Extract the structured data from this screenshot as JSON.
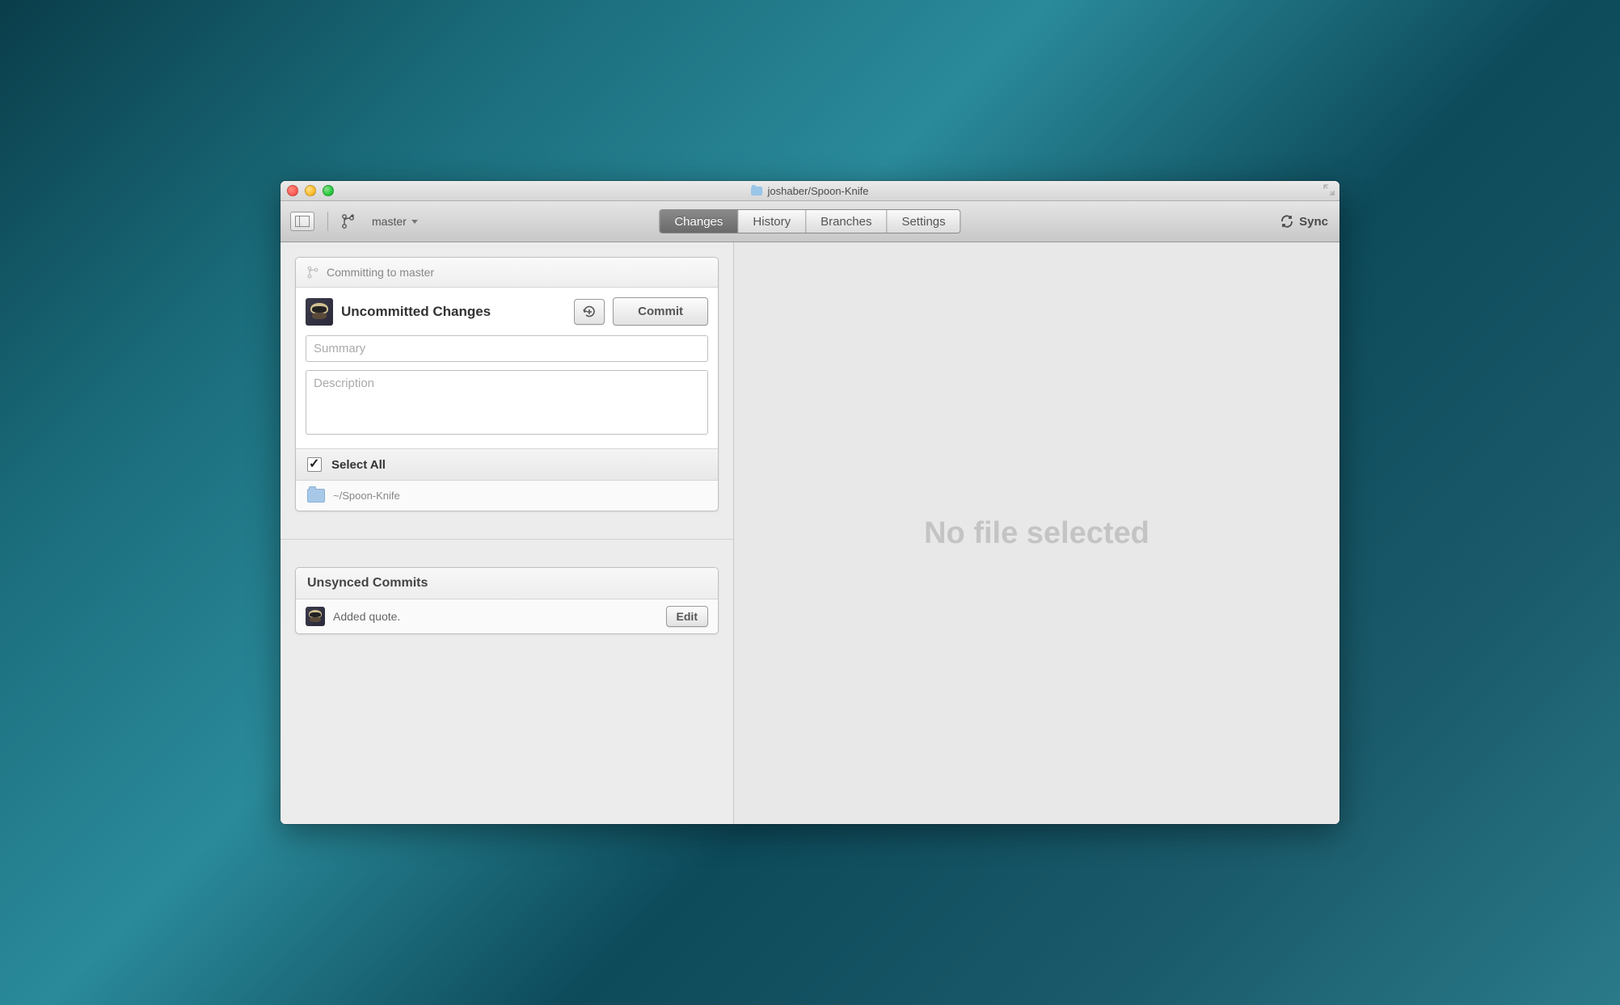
{
  "window": {
    "title": "joshaber/Spoon-Knife"
  },
  "toolbar": {
    "branch": "master",
    "tabs": {
      "changes": "Changes",
      "history": "History",
      "branches": "Branches",
      "settings": "Settings"
    },
    "sync": "Sync"
  },
  "changes": {
    "committing_to": "Committing to master",
    "title": "Uncommitted Changes",
    "commit_button": "Commit",
    "summary_placeholder": "Summary",
    "description_placeholder": "Description",
    "select_all": "Select All",
    "repo_path": "~/Spoon-Knife"
  },
  "unsynced": {
    "title": "Unsynced Commits",
    "commits": [
      {
        "message": "Added quote."
      }
    ],
    "edit": "Edit"
  },
  "detail": {
    "empty": "No file selected"
  }
}
